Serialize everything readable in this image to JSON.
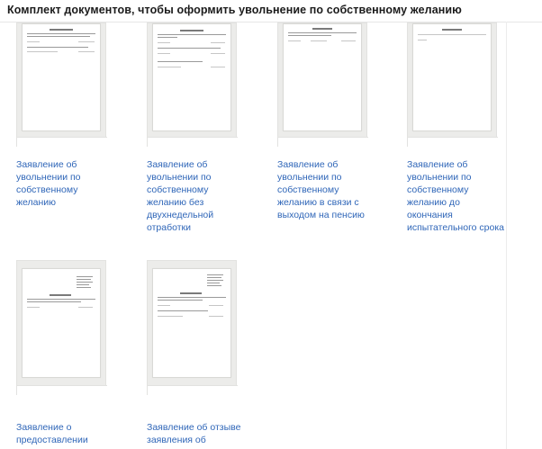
{
  "page": {
    "title": "Комплект документов, чтобы оформить увольнение по собственному желанию"
  },
  "documents": [
    {
      "label": "Заявление об\nувольнении по\nсобственному\nжеланию"
    },
    {
      "label": "Заявление об\nувольнении по\nсобственному\nжеланию без\nдвухнедельной\nотработки"
    },
    {
      "label": "Заявление об\nувольнении по\nсобственному\nжеланию в связи с\nвыходом на пенсию"
    },
    {
      "label": "Заявление об\nувольнении по\nсобственному\nжеланию до\nокончания\nиспытательного срока"
    },
    {
      "label": "Заявление о\nпредоставлении"
    },
    {
      "label": "Заявление об отзыве\nзаявления об"
    }
  ]
}
